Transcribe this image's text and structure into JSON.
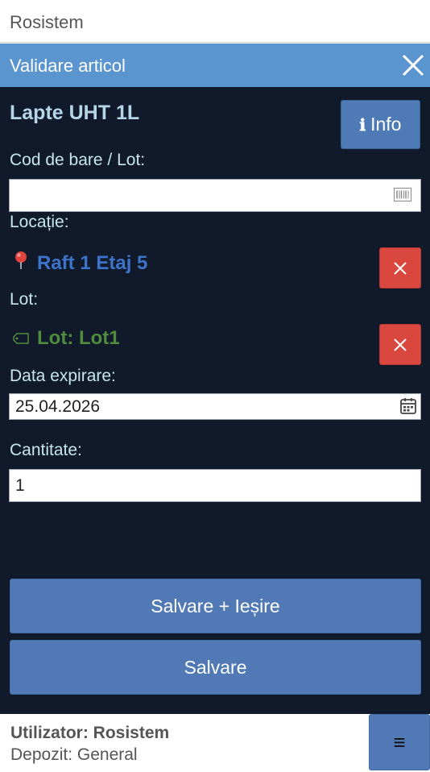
{
  "app": {
    "title": "Rosistem"
  },
  "dialog": {
    "title": "Validare articol",
    "close_icon": "close-icon"
  },
  "product": {
    "name": "Lapte UHT 1L",
    "info_glyph": "ℹ",
    "info_label": "Info"
  },
  "barcode": {
    "label": "Cod de bare / Lot:",
    "value": "",
    "placeholder": "",
    "icon": "barcode-icon"
  },
  "location": {
    "label": "Locație:",
    "value": "Raft 1 Etaj 5",
    "icon": "map-pin-icon",
    "color": "#3d74c9"
  },
  "lot": {
    "label": "Lot:",
    "value": "Lot: Lot1",
    "icon": "tag-icon",
    "color": "#4f8d3c"
  },
  "expiry": {
    "label": "Data expirare:",
    "value": "25.04.2026",
    "icon": "calendar-icon"
  },
  "quantity": {
    "label": "Cantitate:",
    "value": "1"
  },
  "actions": {
    "save_exit_label": "Salvare + Ieșire",
    "save_label": "Salvare"
  },
  "footer": {
    "user_label": "Utilizator: Rosistem",
    "depot_label": "Depozit: General",
    "menu_glyph": "≡",
    "menu_icon": "hamburger-menu-icon"
  },
  "colors": {
    "header": "#5b95cf",
    "body": "#111a2b",
    "primary_button": "#5079b5",
    "danger_button": "#d9473e"
  }
}
